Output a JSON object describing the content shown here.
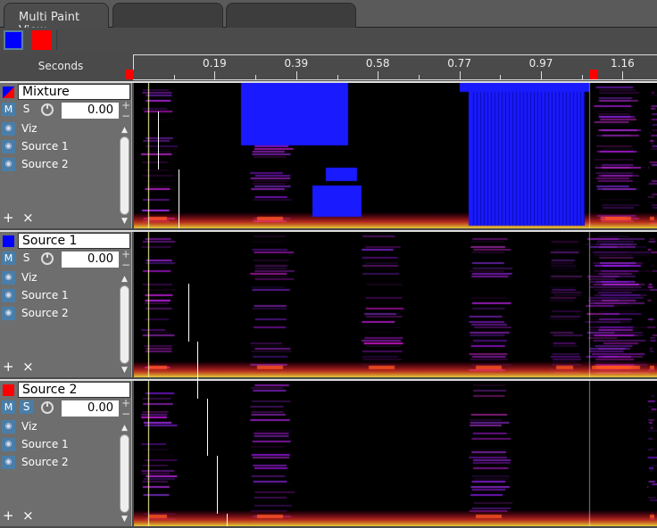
{
  "tabs": [
    {
      "label": "Multi Paint View"
    },
    {
      "label": ""
    },
    {
      "label": ""
    }
  ],
  "toolbar": {
    "colors": [
      "#0000ff",
      "#ff0000"
    ]
  },
  "ruler": {
    "label": "Seconds",
    "ticks": [
      "0.19",
      "0.39",
      "0.58",
      "0.77",
      "0.97",
      "1.16"
    ]
  },
  "panels": [
    {
      "name": "Mixture",
      "m": "M",
      "s": "S",
      "gain": "0.00",
      "rows": [
        "Viz",
        "Source 1",
        "Source 2"
      ],
      "color": "mixed"
    },
    {
      "name": "Source 1",
      "m": "M",
      "s": "S",
      "gain": "0.00",
      "rows": [
        "Viz",
        "Source 1",
        "Source 2"
      ],
      "color": "#0000ff"
    },
    {
      "name": "Source 2",
      "m": "M",
      "s": "S",
      "gain": "0.00",
      "rows": [
        "Viz",
        "Source 1",
        "Source 2"
      ],
      "color": "#ff0000"
    }
  ],
  "icons": {
    "add": "+",
    "remove": "×",
    "plus": "+",
    "minus": "−"
  }
}
